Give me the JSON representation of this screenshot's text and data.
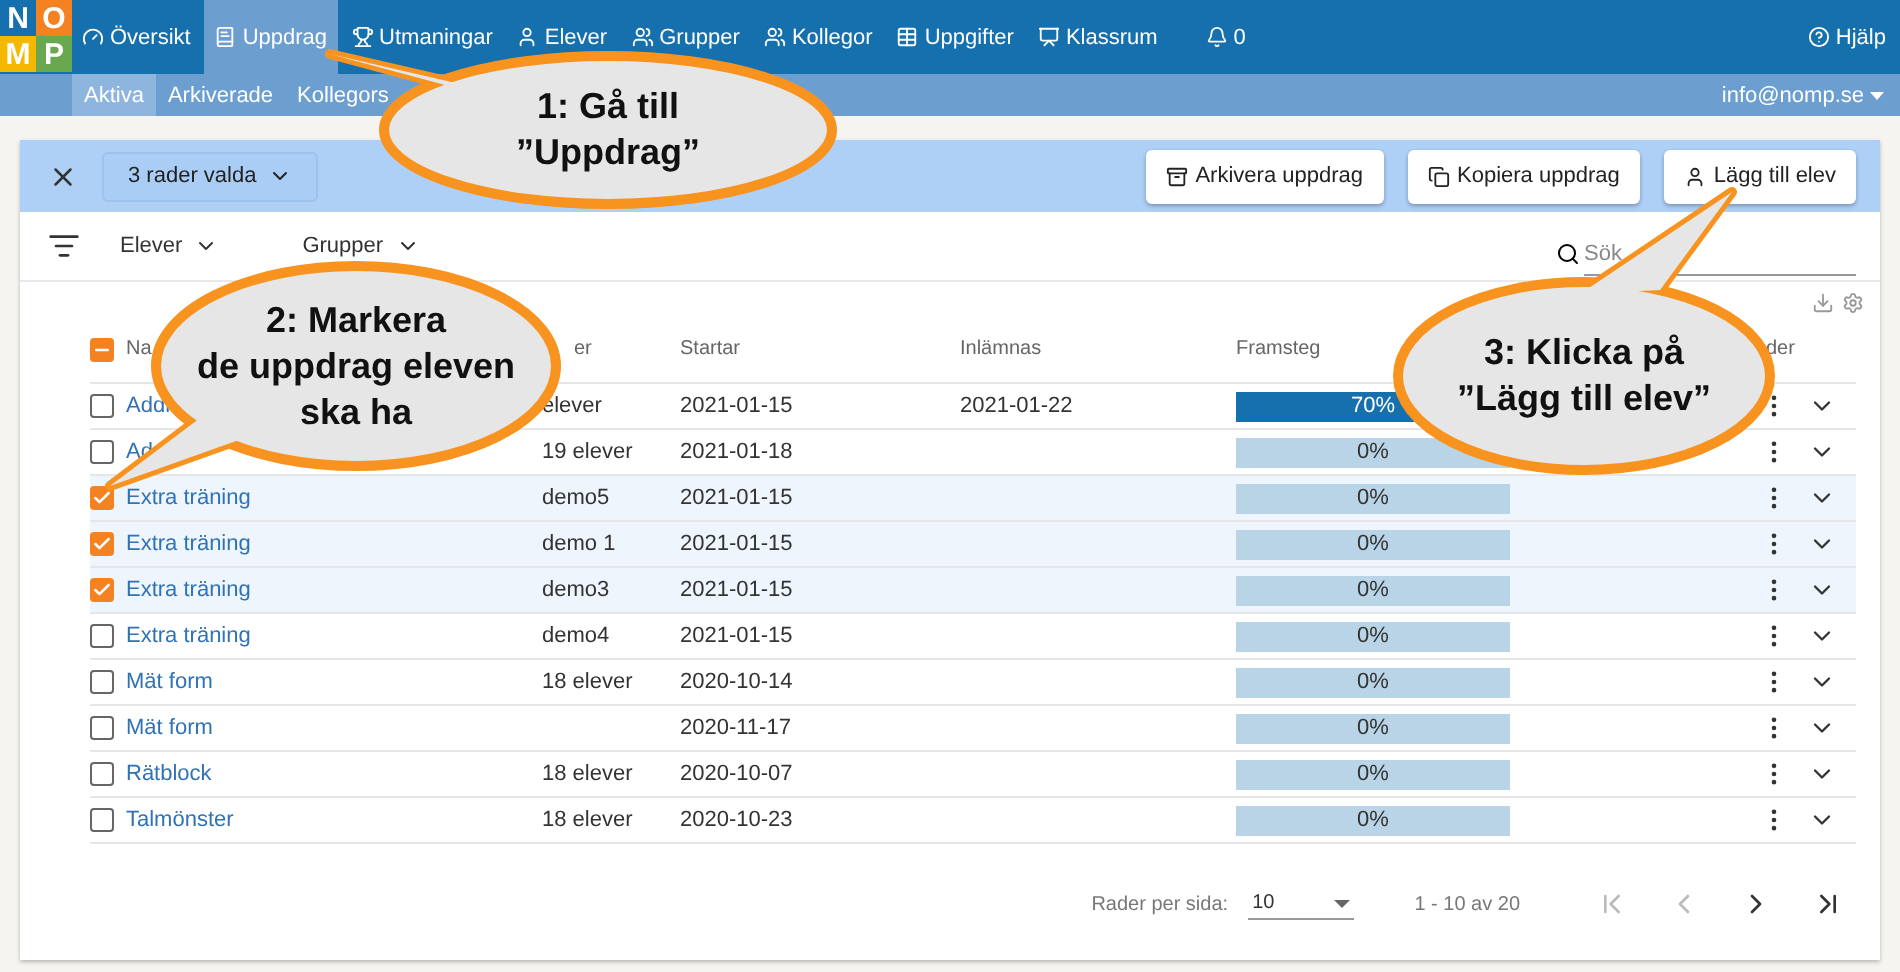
{
  "logo": {
    "letters": [
      "N",
      "O",
      "M",
      "P"
    ]
  },
  "nav": {
    "items": [
      {
        "label": "Översikt",
        "selected": false
      },
      {
        "label": "Uppdrag",
        "selected": true
      },
      {
        "label": "Utmaningar",
        "selected": false
      },
      {
        "label": "Elever",
        "selected": false
      },
      {
        "label": "Grupper",
        "selected": false
      },
      {
        "label": "Kollegor",
        "selected": false
      },
      {
        "label": "Uppgifter",
        "selected": false
      },
      {
        "label": "Klassrum",
        "selected": false
      },
      {
        "label": "0",
        "selected": false
      }
    ],
    "help": "Hjälp"
  },
  "subnav": {
    "tabs": [
      {
        "label": "Aktiva",
        "selected": true
      },
      {
        "label": "Arkiverade",
        "selected": false
      },
      {
        "label": "Kollegors",
        "selected": false
      }
    ],
    "account": "info@nomp.se"
  },
  "selection_bar": {
    "count": "3 rader valda",
    "actions": [
      "Arkivera uppdrag",
      "Kopiera uppdrag",
      "Lägg till elev"
    ]
  },
  "filters": {
    "items": [
      "Elever",
      "Grupper"
    ],
    "search": {
      "placeholder": "Sök"
    }
  },
  "table": {
    "columns": [
      "Na",
      "er",
      "Startar",
      "Inlämnas",
      "Framsteg",
      "der"
    ],
    "header_checkbox": {
      "indeterminate": true
    },
    "rows": [
      {
        "checked": false,
        "name": "Addi",
        "students": "elever",
        "start": "2021-01-15",
        "due": "2021-01-22",
        "progress": "70%",
        "level": 0.7
      },
      {
        "checked": false,
        "name": "Ad",
        "students": "19 elever",
        "start": "2021-01-18",
        "due": "",
        "progress": "0%",
        "level": 0
      },
      {
        "checked": true,
        "name": "Extra träning",
        "students": "demo5",
        "start": "2021-01-15",
        "due": "",
        "progress": "0%",
        "level": 0
      },
      {
        "checked": true,
        "name": "Extra träning",
        "students": "demo 1",
        "start": "2021-01-15",
        "due": "",
        "progress": "0%",
        "level": 0
      },
      {
        "checked": true,
        "name": "Extra träning",
        "students": "demo3",
        "start": "2021-01-15",
        "due": "",
        "progress": "0%",
        "level": 0
      },
      {
        "checked": false,
        "name": "Extra träning",
        "students": "demo4",
        "start": "2021-01-15",
        "due": "",
        "progress": "0%",
        "level": 0
      },
      {
        "checked": false,
        "name": "Mät form",
        "students": "18 elever",
        "start": "2020-10-14",
        "due": "",
        "progress": "0%",
        "level": 0
      },
      {
        "checked": false,
        "name": "Mät form",
        "students": "",
        "start": "2020-11-17",
        "due": "",
        "progress": "0%",
        "level": 0
      },
      {
        "checked": false,
        "name": "Rätblock",
        "students": "18 elever",
        "start": "2020-10-07",
        "due": "",
        "progress": "0%",
        "level": 0
      },
      {
        "checked": false,
        "name": "Talmönster",
        "students": "18 elever",
        "start": "2020-10-23",
        "due": "",
        "progress": "0%",
        "level": 0
      }
    ]
  },
  "pagination": {
    "rows_label": "Rader per sida:",
    "rows_value": "10",
    "range": "1 - 10 av 20"
  },
  "callouts": [
    {
      "lines": [
        "1: Gå till",
        "”Uppdrag”"
      ]
    },
    {
      "lines": [
        "2: Markera",
        "de uppdrag eleven",
        "ska ha"
      ]
    },
    {
      "lines": [
        "3: Klicka på",
        "”Lägg till elev”"
      ]
    }
  ]
}
